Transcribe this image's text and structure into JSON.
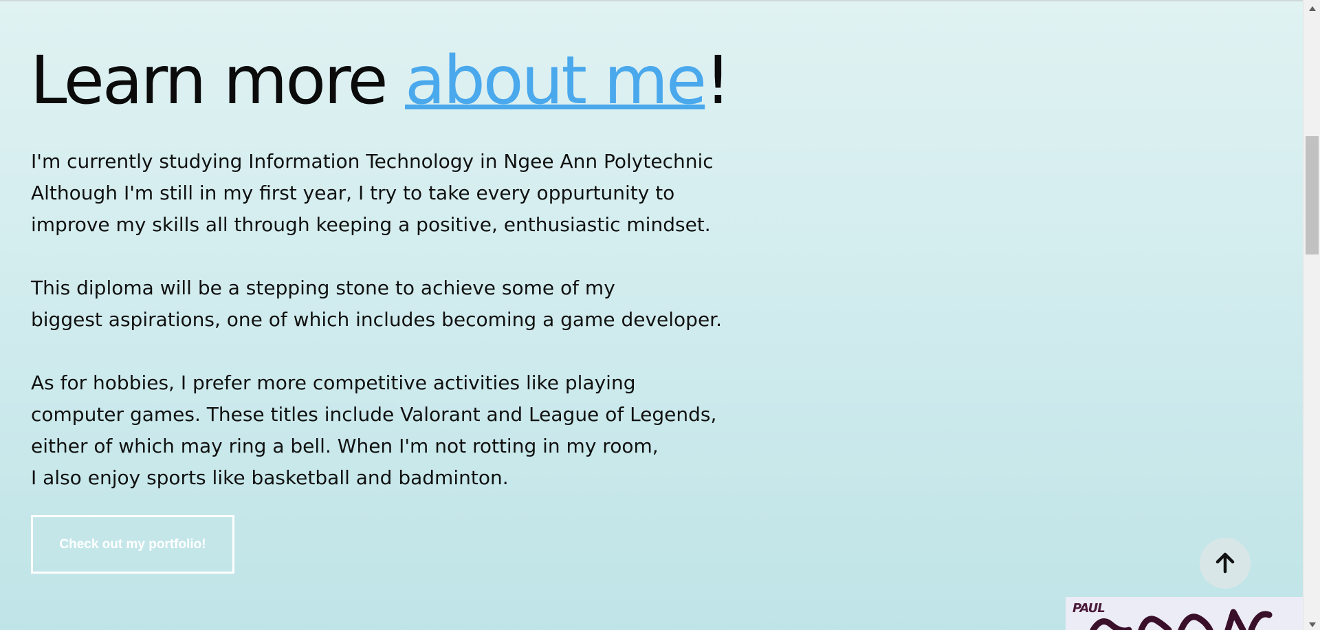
{
  "about": {
    "heading_prefix": "Learn more ",
    "heading_link": "about me",
    "heading_suffix": "!",
    "paragraphs": [
      [
        "I'm currently studying Information Technology in Ngee Ann Polytechnic",
        "Although I'm still in my first year, I try to take every oppurtunity to",
        "improve my skills all through keeping a positive, enthusiastic mindset."
      ],
      [
        "This diploma will be a stepping stone to achieve some of my",
        "biggest aspirations, one of which includes becoming a game developer."
      ],
      [
        "As for hobbies, I prefer more competitive activities like playing",
        "computer games. These titles include Valorant and League of Legends,",
        "either of which may ring a bell. When I'm not rotting in my room,",
        "I also enjoy sports like basketball and badminton."
      ]
    ],
    "cta_label": "Check out my portfolio!"
  },
  "scroll_top": {
    "icon": "arrow-up-icon"
  },
  "thumbnail": {
    "label": "PAUL"
  },
  "scrollbar": {
    "up_icon": "triangle-up-icon",
    "down_icon": "triangle-down-icon"
  },
  "colors": {
    "accent": "#4aa8ec",
    "background_top": "#e0f2f2",
    "background_bottom": "#bfe4e7",
    "text": "#111111",
    "button_border": "#ffffff"
  }
}
